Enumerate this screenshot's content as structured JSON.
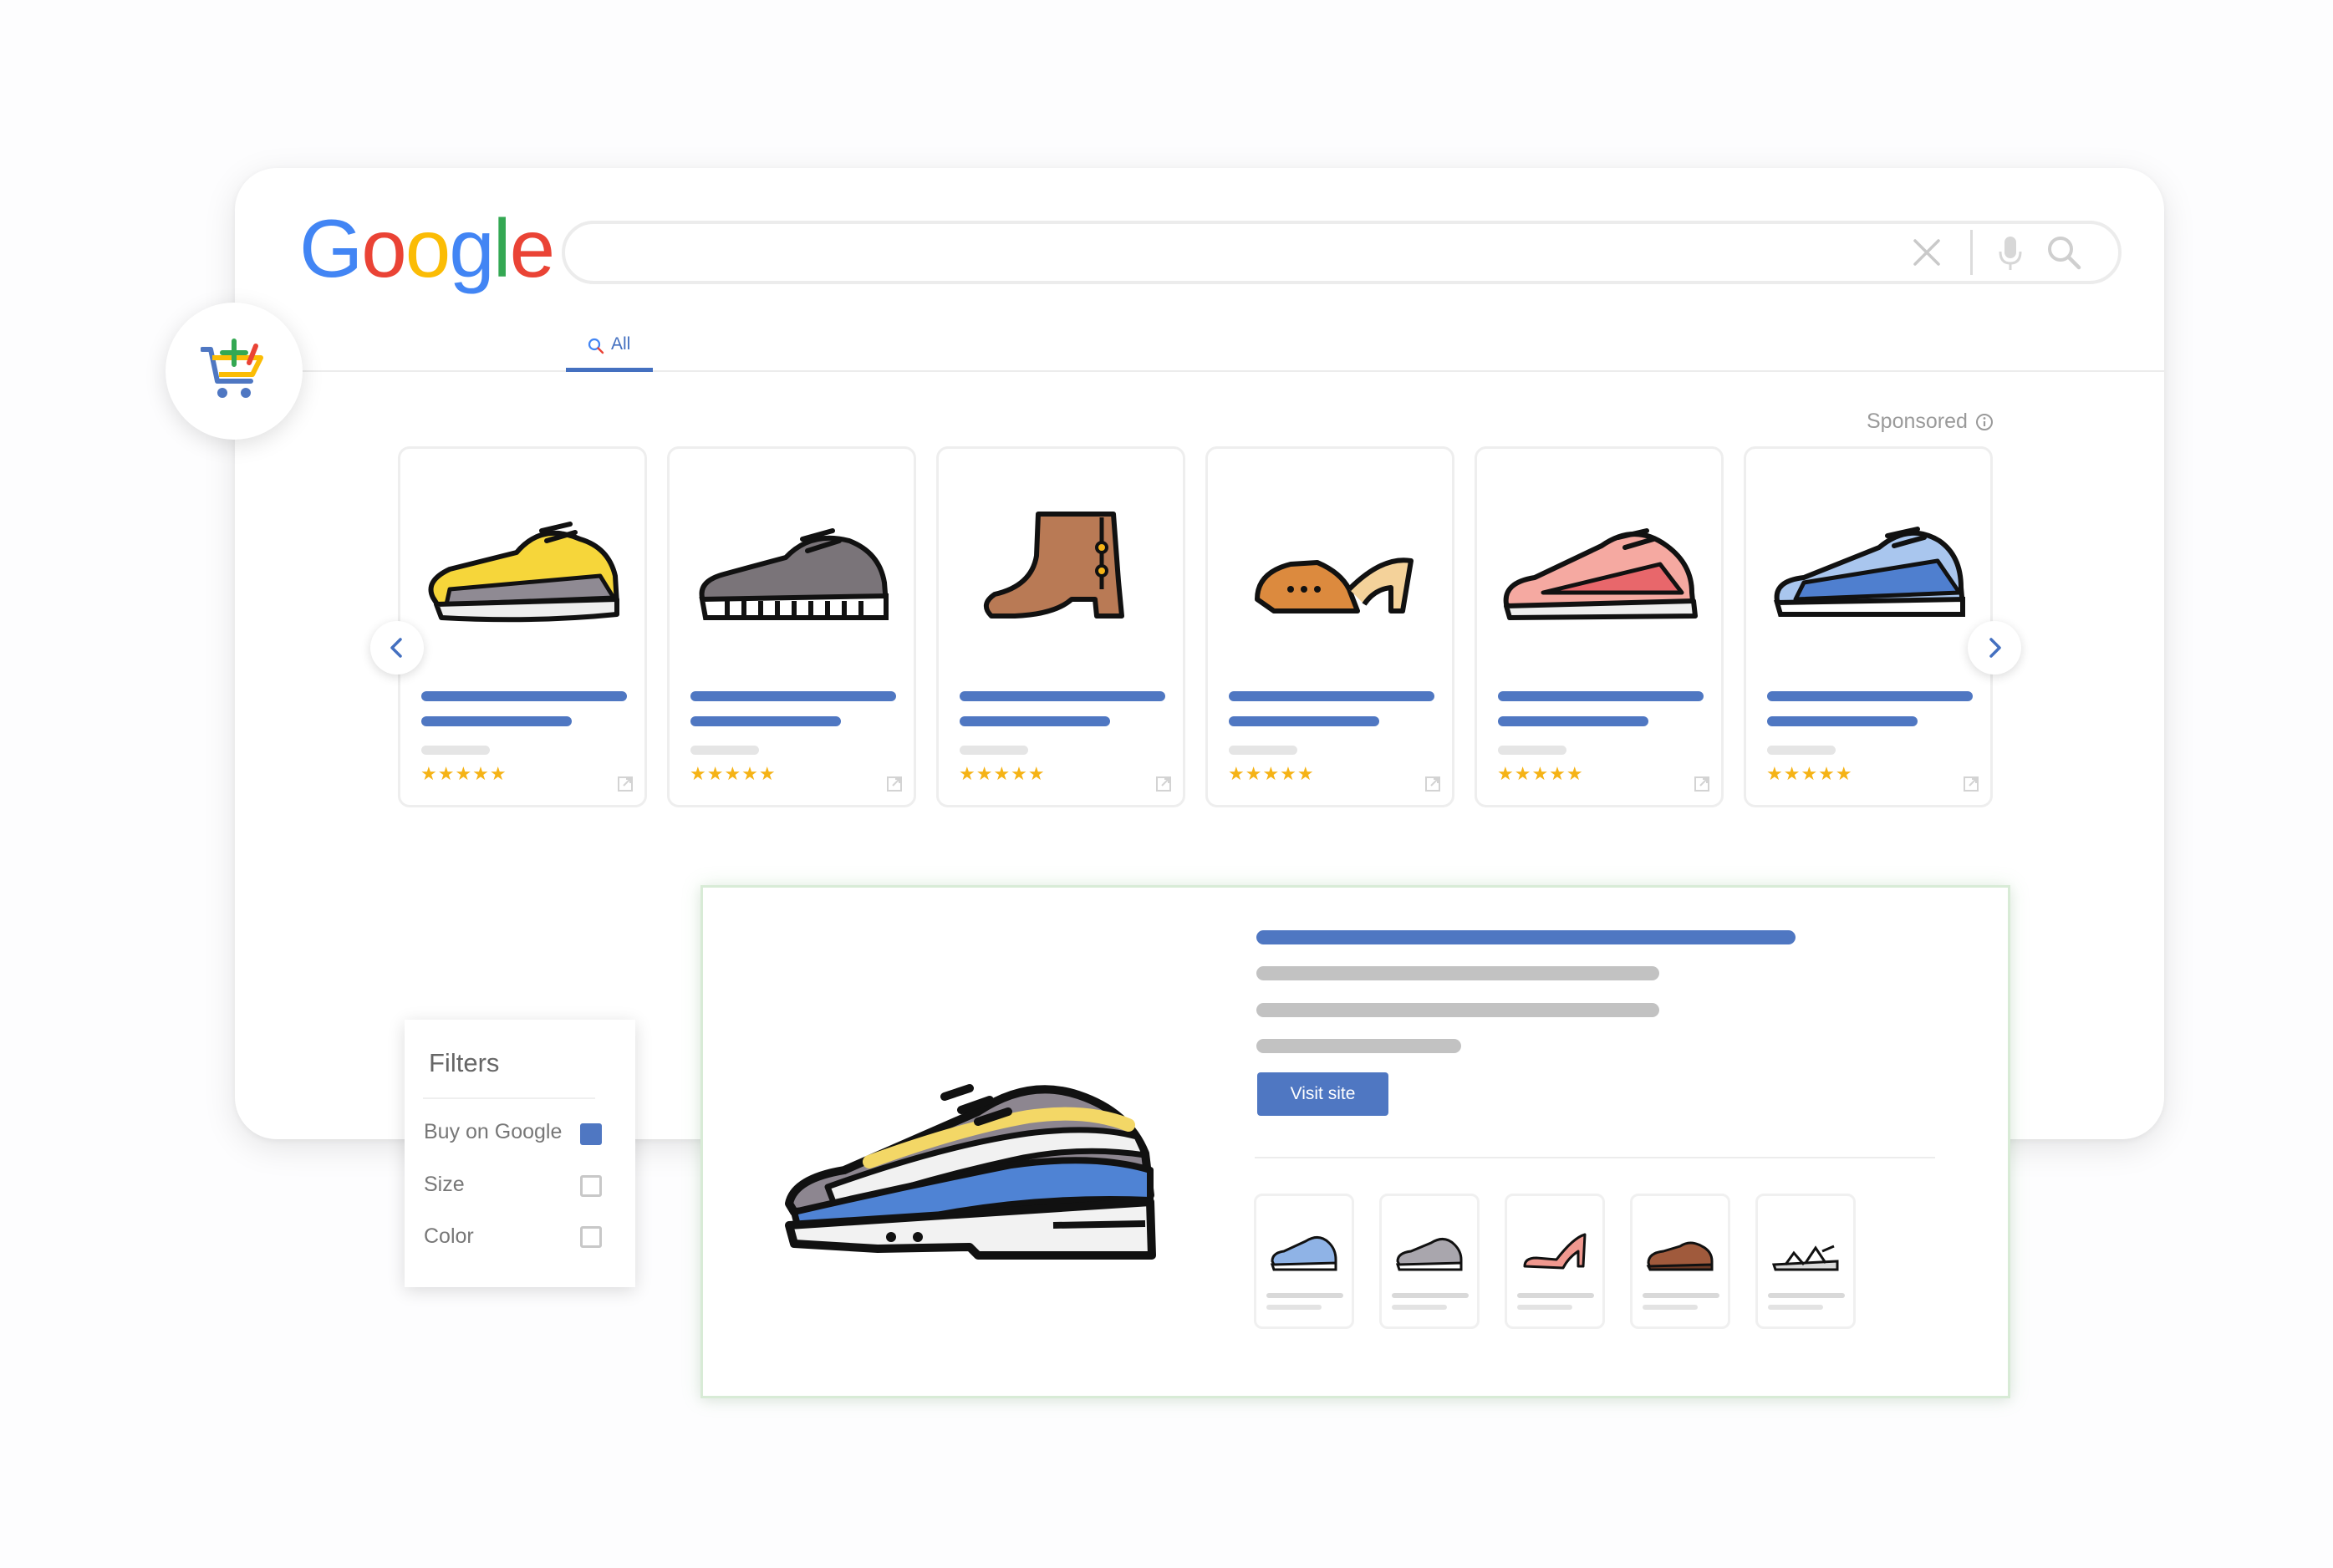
{
  "header": {
    "logo": {
      "text": "Google",
      "letters": [
        "G",
        "o",
        "o",
        "g",
        "l",
        "e"
      ],
      "colors": [
        "#4285F4",
        "#EA4335",
        "#FBBC05",
        "#4285F4",
        "#34A853",
        "#EA4335"
      ]
    },
    "search": {
      "value": "",
      "icons": [
        "clear-icon",
        "mic-icon",
        "search-icon"
      ]
    },
    "tabs": [
      {
        "label": "All",
        "icon": "search-icon",
        "active": true
      }
    ]
  },
  "badge": {
    "icon": "add-to-cart-icon"
  },
  "carousel": {
    "sponsored_label": "Sponsored",
    "prev_icon": "chevron-left-icon",
    "next_icon": "chevron-right-icon",
    "products": [
      {
        "shoe": "yellow-running-sneaker",
        "stars": "★★★★★",
        "rating": 5
      },
      {
        "shoe": "grey-knit-sneaker",
        "stars": "★★★★★",
        "rating": 5
      },
      {
        "shoe": "brown-ankle-boot",
        "stars": "★★★★★",
        "rating": 5
      },
      {
        "shoe": "orange-mule-heel",
        "stars": "★★★★★",
        "rating": 5
      },
      {
        "shoe": "pink-running-sneaker",
        "stars": "★★★★★",
        "rating": 5
      },
      {
        "shoe": "blue-sneaker",
        "stars": "★★★★★",
        "rating": 5
      }
    ]
  },
  "detail": {
    "shoe": "blue-yellow-air-sneaker",
    "visit_label": "Visit site",
    "thumbnails": [
      "blue-sneaker",
      "grey-sneaker",
      "pink-heel",
      "brown-oxford",
      "sandal"
    ]
  },
  "filters": {
    "title": "Filters",
    "options": [
      {
        "label": "Buy on Google",
        "checked": true
      },
      {
        "label": "Size",
        "checked": false
      },
      {
        "label": "Color",
        "checked": false
      }
    ]
  },
  "colors": {
    "accent": "#4f77c2",
    "star": "#f5b316",
    "placeholder": "#c2c2c2",
    "detail_border": "#d8ebd6"
  }
}
